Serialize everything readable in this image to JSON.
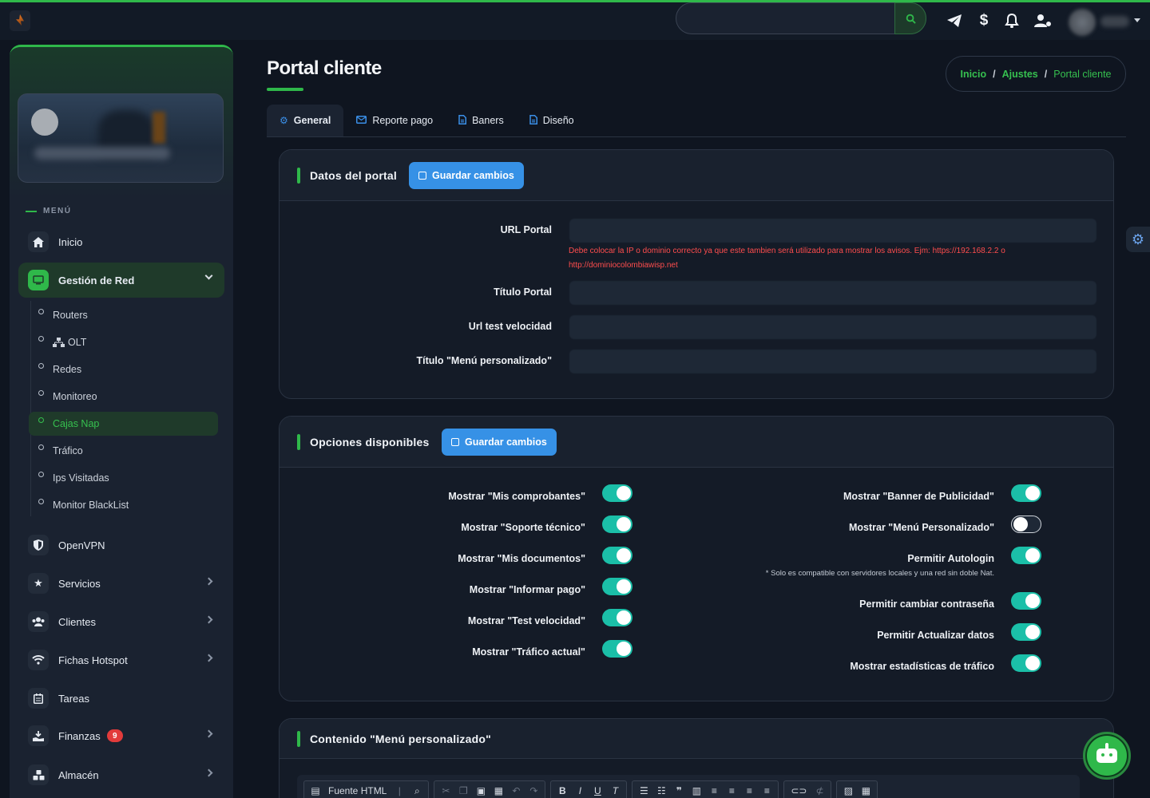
{
  "topbar": {
    "search_placeholder": "",
    "icons": [
      "telegram-icon",
      "dollar-icon",
      "bell-icon",
      "user-settings-icon"
    ]
  },
  "sidebar": {
    "menu_label": "MENÚ",
    "items": [
      {
        "label": "Inicio",
        "icon": "home-icon"
      },
      {
        "label": "Gestión de Red",
        "icon": "network-icon",
        "expanded": true
      },
      {
        "label": "OpenVPN",
        "icon": "shield-icon"
      },
      {
        "label": "Servicios",
        "icon": "star-icon"
      },
      {
        "label": "Clientes",
        "icon": "users-icon"
      },
      {
        "label": "Fichas Hotspot",
        "icon": "wifi-icon"
      },
      {
        "label": "Tareas",
        "icon": "calendar-icon"
      },
      {
        "label": "Finanzas",
        "icon": "finance-icon",
        "badge": "9"
      },
      {
        "label": "Almacén",
        "icon": "boxes-icon"
      }
    ],
    "subitems": [
      "Routers",
      "OLT",
      "Redes",
      "Monitoreo",
      "Cajas Nap",
      "Tráfico",
      "Ips Visitadas",
      "Monitor BlackList"
    ],
    "active_subitem": "Cajas Nap"
  },
  "page": {
    "title": "Portal cliente",
    "breadcrumb": [
      "Inicio",
      "Ajustes",
      "Portal cliente"
    ],
    "tabs": [
      "General",
      "Reporte pago",
      "Baners",
      "Diseño"
    ],
    "active_tab": "General"
  },
  "datos_portal": {
    "title": "Datos del portal",
    "save_label": "Guardar cambios",
    "fields": [
      {
        "label": "URL Portal",
        "value": ""
      },
      {
        "label": "Título Portal",
        "value": ""
      },
      {
        "label": "Url test velocidad",
        "value": ""
      },
      {
        "label": "Título \"Menú personalizado\"",
        "value": ""
      }
    ],
    "url_hint": "Debe colocar la IP o dominio correcto ya que este tambien será utilizado para mostrar los avisos. Ejm: https://192.168.2.2 o http://dominiocolombiawisp.net"
  },
  "opciones": {
    "title": "Opciones disponibles",
    "save_label": "Guardar cambios",
    "left": [
      {
        "label": "Mostrar \"Mis comprobantes\"",
        "on": true
      },
      {
        "label": "Mostrar \"Soporte técnico\"",
        "on": true
      },
      {
        "label": "Mostrar \"Mis documentos\"",
        "on": true
      },
      {
        "label": "Mostrar \"Informar pago\"",
        "on": true
      },
      {
        "label": "Mostrar \"Test velocidad\"",
        "on": true
      },
      {
        "label": "Mostrar \"Tráfico actual\"",
        "on": true
      }
    ],
    "right": [
      {
        "label": "Mostrar \"Banner de Publicidad\"",
        "on": true
      },
      {
        "label": "Mostrar \"Menú Personalizado\"",
        "on": false
      },
      {
        "label": "Permitir Autologin",
        "on": true
      },
      {
        "label": "Permitir cambiar contraseña",
        "on": true
      },
      {
        "label": "Permitir Actualizar datos",
        "on": true
      },
      {
        "label": "Mostrar estadísticas de tráfico",
        "on": true
      }
    ],
    "autologin_note": "* Solo es compatible con servidores locales y una red sin doble Nat."
  },
  "contenido": {
    "title": "Contenido \"Menú personalizado\"",
    "editor_source_label": "Fuente HTML"
  },
  "colors": {
    "accent": "#2fb84a",
    "button": "#3691e6",
    "toggle_on": "#1bbfa8",
    "error": "#ff4d4d"
  }
}
